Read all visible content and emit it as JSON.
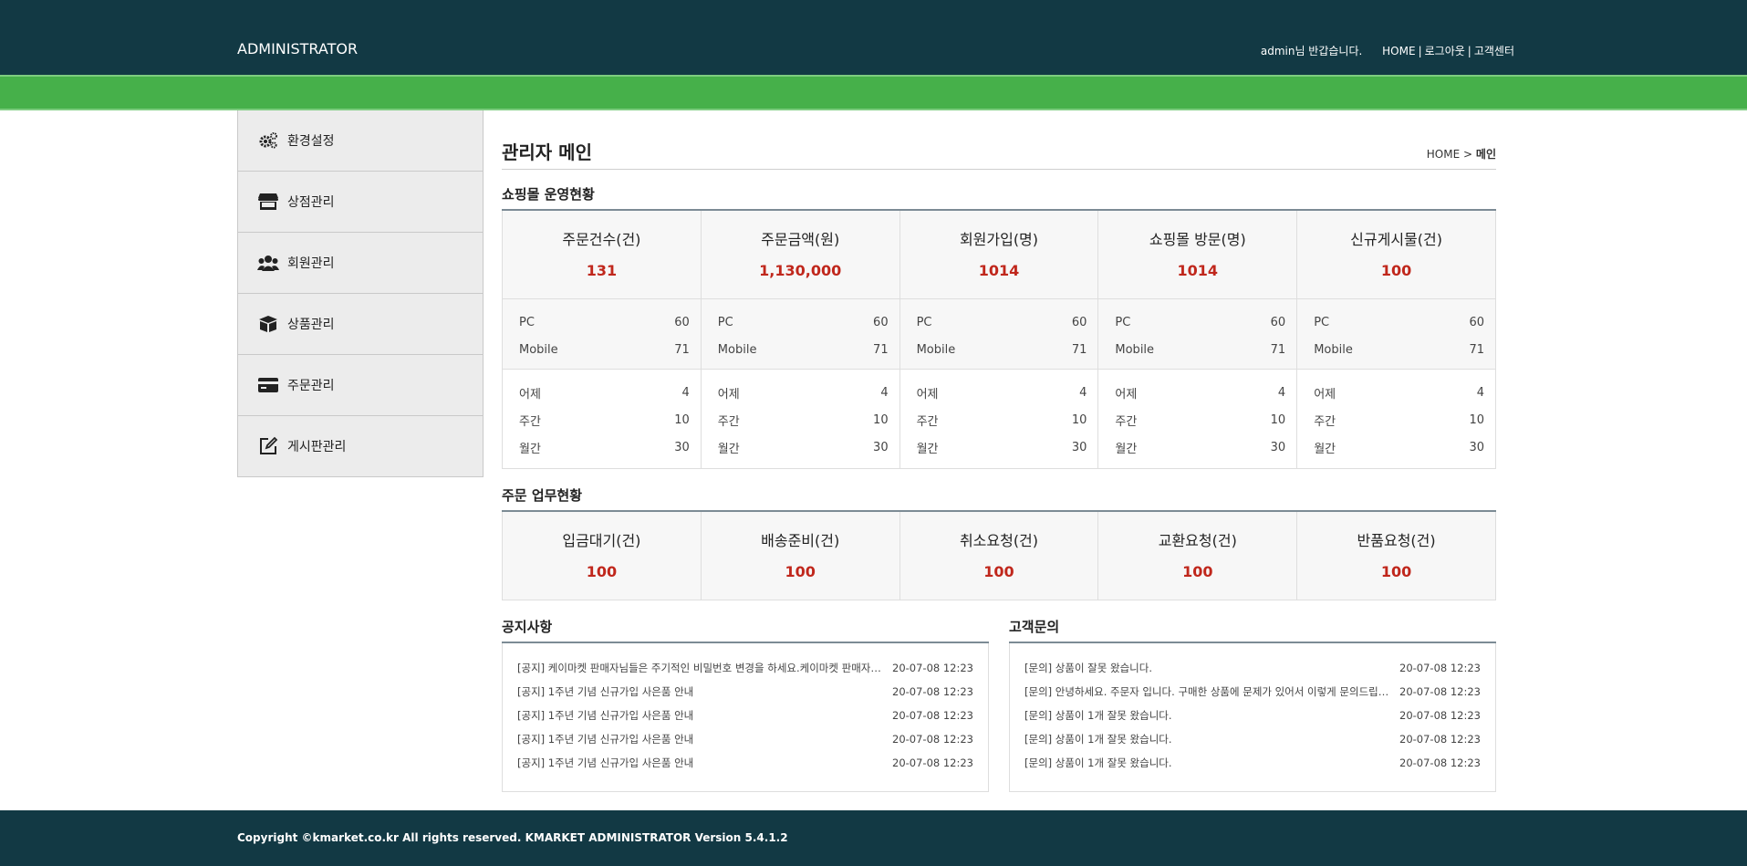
{
  "header": {
    "brand": "ADMINISTRATOR",
    "welcome": "admin님 반갑습니다.",
    "links": [
      "HOME",
      "로그아웃",
      "고객센터"
    ]
  },
  "colors": {
    "header_bg": "#123944",
    "green_bar": "#46b04a",
    "value_red": "#c0271c"
  },
  "sidebar": {
    "items": [
      {
        "label": "환경설정",
        "icon": "gears-icon"
      },
      {
        "label": "상점관리",
        "icon": "store-icon"
      },
      {
        "label": "회원관리",
        "icon": "users-icon"
      },
      {
        "label": "상품관리",
        "icon": "box-icon"
      },
      {
        "label": "주문관리",
        "icon": "credit-card-icon"
      },
      {
        "label": "게시판관리",
        "icon": "edit-icon"
      }
    ]
  },
  "page": {
    "title": "관리자 메인",
    "breadcrumb": {
      "home": "HOME",
      "sep": ">",
      "current": "메인"
    }
  },
  "operation": {
    "title": "쇼핑몰 운영현황",
    "columns": [
      {
        "name": "주문건수(건)",
        "value": "131",
        "pc_label": "PC",
        "pc": "60",
        "mobile_label": "Mobile",
        "mobile": "71",
        "yesterday_label": "어제",
        "yesterday": "4",
        "weekly_label": "주간",
        "weekly": "10",
        "monthly_label": "월간",
        "monthly": "30"
      },
      {
        "name": "주문금액(원)",
        "value": "1,130,000",
        "pc_label": "PC",
        "pc": "60",
        "mobile_label": "Mobile",
        "mobile": "71",
        "yesterday_label": "어제",
        "yesterday": "4",
        "weekly_label": "주간",
        "weekly": "10",
        "monthly_label": "월간",
        "monthly": "30"
      },
      {
        "name": "회원가입(명)",
        "value": "1014",
        "pc_label": "PC",
        "pc": "60",
        "mobile_label": "Mobile",
        "mobile": "71",
        "yesterday_label": "어제",
        "yesterday": "4",
        "weekly_label": "주간",
        "weekly": "10",
        "monthly_label": "월간",
        "monthly": "30"
      },
      {
        "name": "쇼핑몰 방문(명)",
        "value": "1014",
        "pc_label": "PC",
        "pc": "60",
        "mobile_label": "Mobile",
        "mobile": "71",
        "yesterday_label": "어제",
        "yesterday": "4",
        "weekly_label": "주간",
        "weekly": "10",
        "monthly_label": "월간",
        "monthly": "30"
      },
      {
        "name": "신규게시물(건)",
        "value": "100",
        "pc_label": "PC",
        "pc": "60",
        "mobile_label": "Mobile",
        "mobile": "71",
        "yesterday_label": "어제",
        "yesterday": "4",
        "weekly_label": "주간",
        "weekly": "10",
        "monthly_label": "월간",
        "monthly": "30"
      }
    ]
  },
  "orders": {
    "title": "주문 업무현황",
    "columns": [
      {
        "name": "입금대기(건)",
        "value": "100"
      },
      {
        "name": "배송준비(건)",
        "value": "100"
      },
      {
        "name": "취소요청(건)",
        "value": "100"
      },
      {
        "name": "교환요청(건)",
        "value": "100"
      },
      {
        "name": "반품요청(건)",
        "value": "100"
      }
    ]
  },
  "notice": {
    "title": "공지사항",
    "posts": [
      {
        "title": "[공지] 케이마켓 판매자님들은 주기적인 비밀번호 변경을 하세요.케이마켓 판매자님들은 주기적인 비밀번호 변경을 하세요.",
        "date": "20-07-08 12:23"
      },
      {
        "title": "[공지] 1주년 기념 신규가입 사은품 안내",
        "date": "20-07-08 12:23"
      },
      {
        "title": "[공지] 1주년 기념 신규가입 사은품 안내",
        "date": "20-07-08 12:23"
      },
      {
        "title": "[공지] 1주년 기념 신규가입 사은품 안내",
        "date": "20-07-08 12:23"
      },
      {
        "title": "[공지] 1주년 기념 신규가입 사은품 안내",
        "date": "20-07-08 12:23"
      }
    ]
  },
  "qna": {
    "title": "고객문의",
    "posts": [
      {
        "title": "[문의] 상품이 잘못 왔습니다.",
        "date": "20-07-08 12:23"
      },
      {
        "title": "[문의] 안녕하세요. 주문자 입니다. 구매한 상품에 문제가 있어서 이렇게 문의드립니다.",
        "date": "20-07-08 12:23"
      },
      {
        "title": "[문의] 상품이 1개 잘못 왔습니다.",
        "date": "20-07-08 12:23"
      },
      {
        "title": "[문의] 상품이 1개 잘못 왔습니다.",
        "date": "20-07-08 12:23"
      },
      {
        "title": "[문의] 상품이 1개 잘못 왔습니다.",
        "date": "20-07-08 12:23"
      }
    ]
  },
  "footer": {
    "copyright": "Copyright ©kmarket.co.kr All rights reserved. KMARKET ADMINISTRATOR Version 5.4.1.2"
  }
}
